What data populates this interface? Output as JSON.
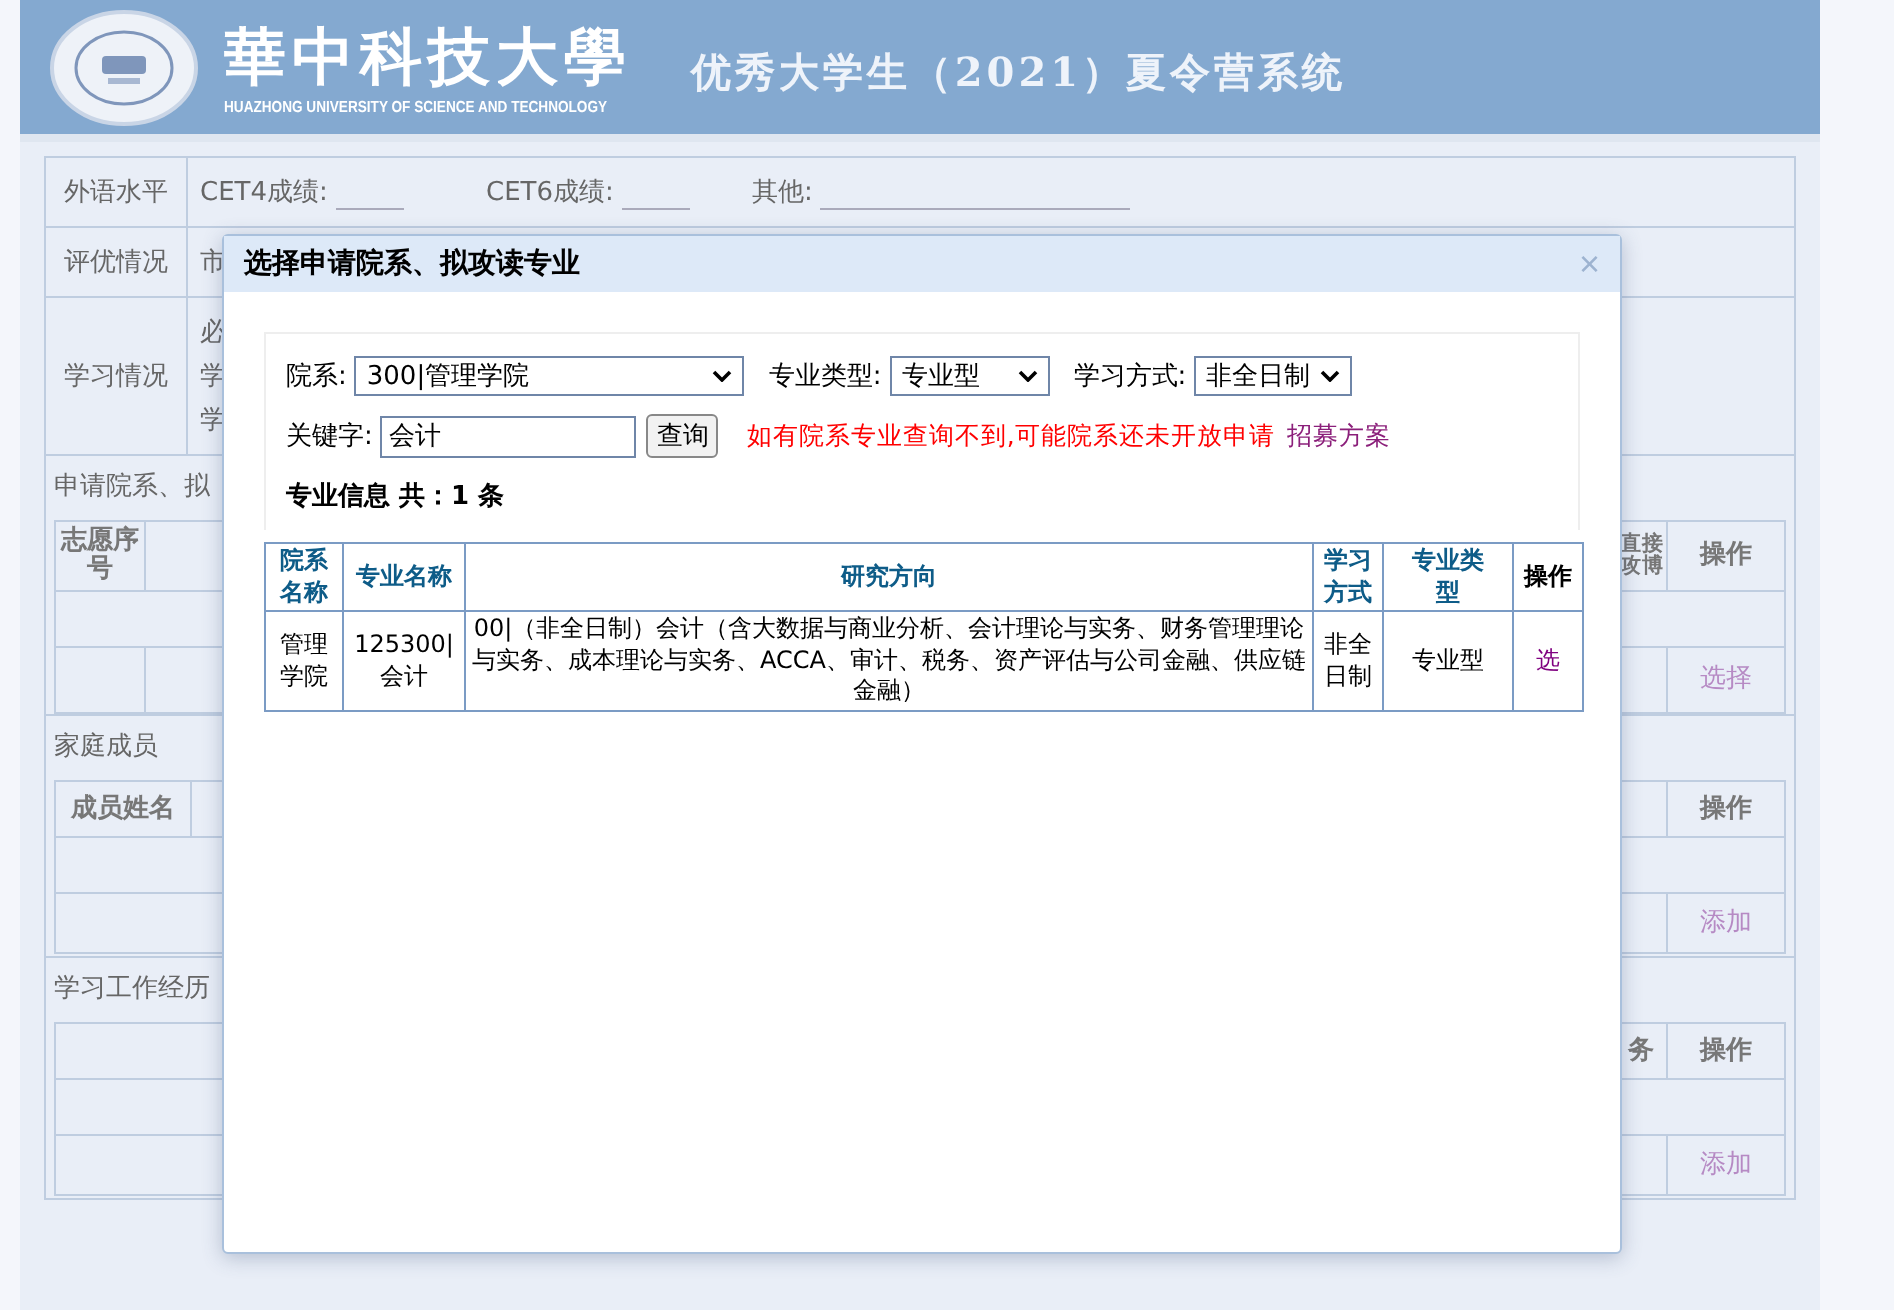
{
  "header": {
    "school_name": "華中科技大學",
    "school_name_en": "HUAZHONG UNIVERSITY OF SCIENCE AND TECHNOLOGY",
    "system_title": "优秀大学生（2021）夏令营系统"
  },
  "form": {
    "language": {
      "label": "外语水平",
      "fields": [
        {
          "label": "CET4成绩:"
        },
        {
          "label": "CET6成绩:"
        },
        {
          "label": "其他:"
        }
      ]
    },
    "awards": {
      "label": "评优情况",
      "text": "市"
    },
    "study": {
      "label": "学习情况",
      "lines": [
        "必",
        "学",
        "学"
      ]
    },
    "application": {
      "title": "申请院系、拟",
      "columns": [
        "志愿序号",
        "直接攻博",
        "操作"
      ],
      "action": "选择"
    },
    "family": {
      "title": "家庭成员",
      "columns": [
        "成员姓名",
        "操作"
      ],
      "action": "添加"
    },
    "experience": {
      "title": "学习工作经历",
      "columns": [
        "务",
        "操作"
      ],
      "action": "添加"
    }
  },
  "dialog": {
    "title": "选择申请院系、拟攻读专业",
    "close": "×",
    "filters": [
      {
        "label": "院系:",
        "value": "300|管理学院",
        "kind": "select"
      },
      {
        "label": "专业类型:",
        "value": "专业型",
        "kind": "select"
      },
      {
        "label": "学习方式:",
        "value": "非全日制",
        "kind": "select"
      }
    ],
    "keyword": {
      "label": "关键字:",
      "value": "会计"
    },
    "search_button": "查询",
    "notice": "如有院系专业查询不到,可能院系还未开放申请",
    "link": "招募方案",
    "result_title": "专业信息 共：1 条",
    "table": {
      "columns": [
        "院系名称",
        "专业名称",
        "研究方向",
        "学习方式",
        "专业类型",
        "操作"
      ],
      "rows": [
        {
          "cells": [
            "管理学院",
            "125300|会计",
            "00|（非全日制）会计（含大数据与商业分析、会计理论与实务、财务管理理论与实务、成本理论与实务、ACCA、审计、税务、资产评估与公司金融、供应链金融）",
            "非全日制",
            "专业型"
          ],
          "action": "选"
        }
      ]
    }
  }
}
